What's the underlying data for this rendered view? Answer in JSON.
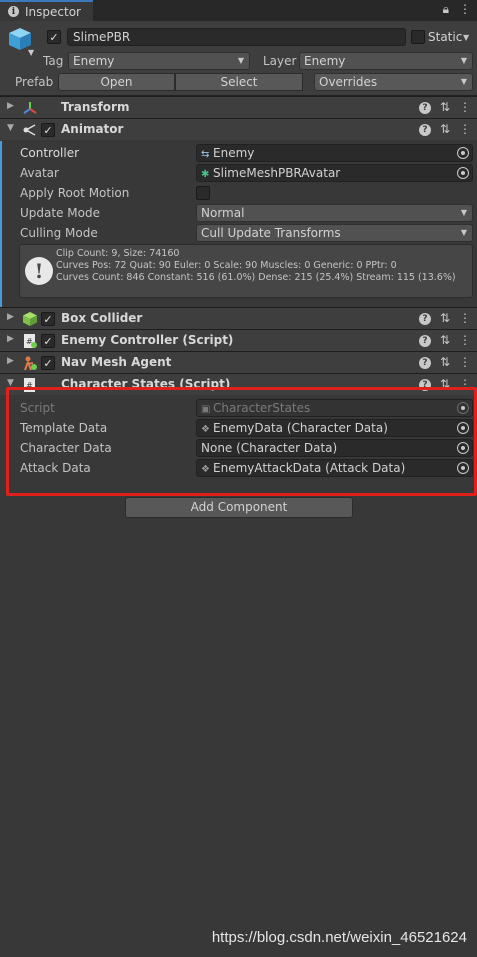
{
  "tab": {
    "title": "Inspector"
  },
  "object": {
    "name": "SlimePBR",
    "static_label": "Static",
    "tag_label": "Tag",
    "tag_value": "Enemy",
    "layer_label": "Layer",
    "layer_value": "Enemy",
    "prefab_label": "Prefab",
    "open_label": "Open",
    "select_label": "Select",
    "overrides_label": "Overrides"
  },
  "components": {
    "transform": "Transform",
    "animator": "Animator",
    "box_collider": "Box Collider",
    "enemy_controller": "Enemy Controller (Script)",
    "nav_mesh_agent": "Nav Mesh Agent",
    "character_states": "Character States (Script)"
  },
  "animator": {
    "controller_label": "Controller",
    "controller_value": "Enemy",
    "avatar_label": "Avatar",
    "avatar_value": "SlimeMeshPBRAvatar",
    "root_motion_label": "Apply Root Motion",
    "update_mode_label": "Update Mode",
    "update_mode_value": "Normal",
    "culling_mode_label": "Culling Mode",
    "culling_mode_value": "Cull Update Transforms",
    "info_line1": "Clip Count: 9, Size: 74160",
    "info_line2": "Curves Pos: 72 Quat: 90 Euler: 0 Scale: 90 Muscles: 0 Generic: 0 PPtr: 0",
    "info_line3": "Curves Count: 846 Constant: 516 (61.0%) Dense: 215 (25.4%) Stream: 115 (13.6%)"
  },
  "character_states": {
    "script_label": "Script",
    "script_value": "CharacterStates",
    "template_label": "Template Data",
    "template_value": "EnemyData (Character Data)",
    "character_label": "Character Data",
    "character_value": "None (Character Data)",
    "attack_label": "Attack Data",
    "attack_value": "EnemyAttackData (Attack Data)"
  },
  "add_component_label": "Add Component",
  "watermark": "https://blog.csdn.net/weixin_46521624",
  "colors": {
    "accent": "#4a9bd8",
    "highlight_box": "#e0201c",
    "background": "#383838"
  }
}
